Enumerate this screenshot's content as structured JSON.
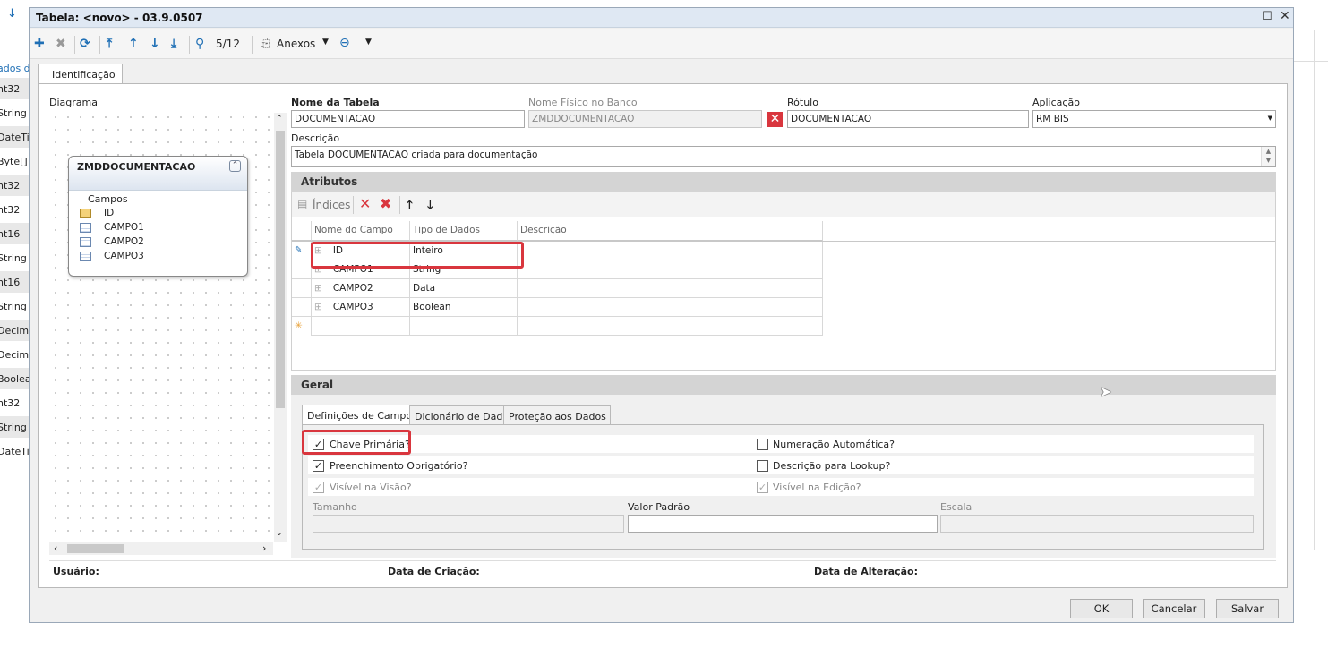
{
  "background_types": [
    "ados da",
    "nt32",
    "String",
    "DateTim",
    "Byte[]",
    "nt32",
    "nt32",
    "nt16",
    "String",
    "nt16",
    "String",
    "Decimal",
    "Decimal",
    "Boolean",
    "nt32",
    "String",
    "DateTim"
  ],
  "window": {
    "title": "Tabela: <novo> - 03.9.0507"
  },
  "toolbar": {
    "counter": "5/12",
    "attachments_label": "Anexos"
  },
  "tabs": {
    "identification": "Identificação"
  },
  "diagram": {
    "label": "Diagrama",
    "entity_name": "ZMDDOCUMENTACAO",
    "fields_label": "Campos",
    "fields": [
      "ID",
      "CAMPO1",
      "CAMPO2",
      "CAMPO3"
    ]
  },
  "form": {
    "table_name_label": "Nome da Tabela",
    "table_name_value": "DOCUMENTACAO",
    "physical_name_label": "Nome Físico no Banco",
    "physical_name_value": "ZMDDOCUMENTACAO",
    "rotulo_label": "Rótulo",
    "rotulo_value": "DOCUMENTACAO",
    "application_label": "Aplicação",
    "application_value": "RM BIS",
    "description_label": "Descrição",
    "description_value": "Tabela DOCUMENTACAO criada para documentação"
  },
  "attributes": {
    "section_title": "Atributos",
    "indices_label": "Índices",
    "columns": [
      "Nome do Campo",
      "Tipo de Dados",
      "Descrição"
    ],
    "rows": [
      {
        "name": "ID",
        "type": "Inteiro",
        "desc": ""
      },
      {
        "name": "CAMPO1",
        "type": "String",
        "desc": ""
      },
      {
        "name": "CAMPO2",
        "type": "Data",
        "desc": ""
      },
      {
        "name": "CAMPO3",
        "type": "Boolean",
        "desc": ""
      }
    ]
  },
  "geral": {
    "section_title": "Geral",
    "subtabs": [
      "Definições de Campos",
      "Dicionário de Dados",
      "Proteção aos Dados"
    ],
    "checks": {
      "primary_key": {
        "label": "Chave Primária?",
        "checked": true
      },
      "auto_number": {
        "label": "Numeração Automática?",
        "checked": false
      },
      "required": {
        "label": "Preenchimento Obrigatório?",
        "checked": true
      },
      "lookup_desc": {
        "label": "Descrição para Lookup?",
        "checked": false
      },
      "visible_view": {
        "label": "Visível na Visão?",
        "checked": true
      },
      "visible_edit": {
        "label": "Visível na Edição?",
        "checked": true
      }
    },
    "size_label": "Tamanho",
    "default_label": "Valor Padrão",
    "scale_label": "Escala"
  },
  "footer": {
    "user_label": "Usuário:",
    "created_label": "Data de Criação:",
    "modified_label": "Data de Alteração:"
  },
  "buttons": {
    "ok": "OK",
    "cancel": "Cancelar",
    "save": "Salvar"
  }
}
